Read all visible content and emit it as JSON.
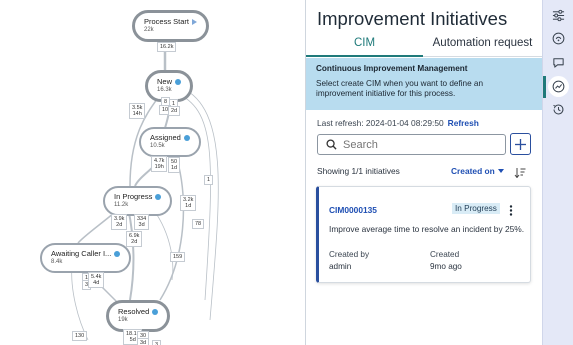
{
  "process_map": {
    "nodes": {
      "start": {
        "name": "Process Start",
        "count": "22k"
      },
      "new": {
        "name": "New",
        "count": "16.3k"
      },
      "assigned": {
        "name": "Assigned",
        "count": "10.5k"
      },
      "in_progress": {
        "name": "In Progress",
        "count": "11.2k"
      },
      "awaiting": {
        "name": "Awaiting Caller I...",
        "count": "8.4k"
      },
      "resolved": {
        "name": "Resolved",
        "count": "19k"
      }
    },
    "edge_labels": [
      {
        "id": "start-new",
        "text": "16.2k"
      },
      {
        "id": "new-self-a",
        "text": "8"
      },
      {
        "id": "new-self-b",
        "text": "1"
      },
      {
        "id": "new-self-c",
        "text": "10"
      },
      {
        "id": "new-self-d",
        "text": "2d"
      },
      {
        "id": "new-ip",
        "text": "3.5k\n14h"
      },
      {
        "id": "asg-a",
        "text": "4.7k\n19h"
      },
      {
        "id": "asg-b",
        "text": "50\n1d"
      },
      {
        "id": "far-1",
        "text": "1"
      },
      {
        "id": "asg-res",
        "text": "3.2k\n1d"
      },
      {
        "id": "far-78",
        "text": "78"
      },
      {
        "id": "ip-a",
        "text": "3.9k\n2d"
      },
      {
        "id": "ip-b",
        "text": "334\n3d"
      },
      {
        "id": "ip-c",
        "text": "6.9k\n2d"
      },
      {
        "id": "mid-159",
        "text": "159"
      },
      {
        "id": "aw-a",
        "text": "1"
      },
      {
        "id": "aw-b",
        "text": "3"
      },
      {
        "id": "aw-c",
        "text": "5.4k\n4d"
      },
      {
        "id": "bot-130",
        "text": "130"
      },
      {
        "id": "res-a",
        "text": "18.1k\n5d"
      },
      {
        "id": "res-b",
        "text": "30"
      },
      {
        "id": "res-c",
        "text": "3d"
      },
      {
        "id": "res-d",
        "text": "3"
      }
    ]
  },
  "panel": {
    "title": "Improvement Initiatives",
    "tabs": [
      "CIM",
      "Automation request"
    ],
    "banner_title": "Continuous Improvement Management",
    "banner_body": "Select create CIM when you want to define an improvement initiative for this process.",
    "refresh_label": "Last refresh: 2024-01-04 08:29:50",
    "refresh_link": "Refresh",
    "search_placeholder": "Search",
    "showing": "Showing 1/1 initiatives",
    "sort_label": "Created on",
    "card": {
      "id": "CIM0000135",
      "status": "In Progress",
      "description": "Improve average time to resolve an incident by 25%.",
      "created_by_label": "Created by",
      "created_by": "admin",
      "created_label": "Created",
      "created": "9mo ago"
    }
  },
  "rail": {
    "icons": [
      "sliders-icon",
      "ai-assist-icon",
      "chat-icon",
      "improvement-icon",
      "history-icon"
    ],
    "active_index": 3
  },
  "colors": {
    "accent": "#1f7a7a",
    "link": "#1f4fb3",
    "banner_bg": "#b8dcef",
    "rail_bg": "#e4e8f7",
    "card_border": "#2a4f9e"
  }
}
